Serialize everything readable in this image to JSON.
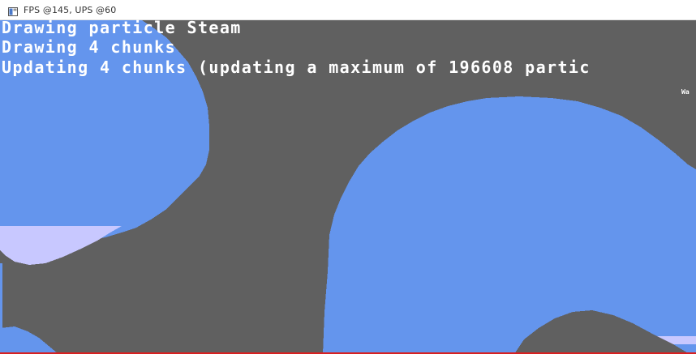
{
  "window": {
    "title": "FPS @145, UPS @60",
    "icon": "app-window-icon"
  },
  "overlay": {
    "line1": "Drawing particle Steam",
    "line2": "Drawing 4 chunks",
    "line3": "Updating 4 chunks (updating a maximum of 196608 partic",
    "corner_label": "Wa"
  },
  "colors": {
    "background": "#606060",
    "water": "#6495ed",
    "steam": "#c8c8ff",
    "text": "#ffffff",
    "accent_border": "#d82020"
  }
}
